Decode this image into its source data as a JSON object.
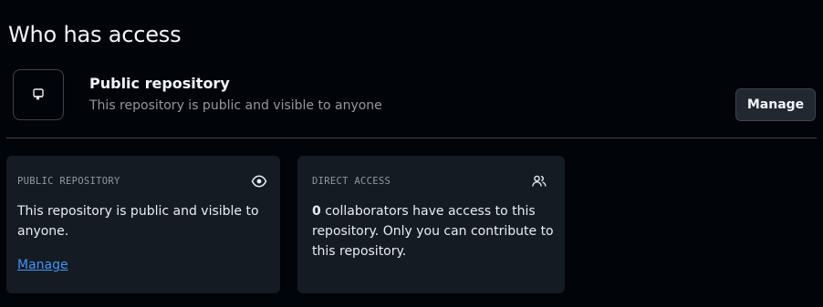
{
  "page": {
    "title": "Who has access"
  },
  "visibility": {
    "icon": "repo-icon",
    "title": "Public repository",
    "description": "This repository is public and visible to anyone",
    "manage_label": "Manage"
  },
  "cards": {
    "public": {
      "heading": "PUBLIC REPOSITORY",
      "icon": "eye-icon",
      "text": "This repository is public and visible to anyone.",
      "link_label": "Manage"
    },
    "direct": {
      "heading": "DIRECT ACCESS",
      "icon": "people-icon",
      "count": "0",
      "text_rest": " collaborators have access to this repository. Only you can contribute to this repository."
    }
  },
  "colors": {
    "background": "#010409",
    "card_bg": "#151b23",
    "border": "#3d444d",
    "link": "#4493f8",
    "muted_text": "#9198a1"
  }
}
